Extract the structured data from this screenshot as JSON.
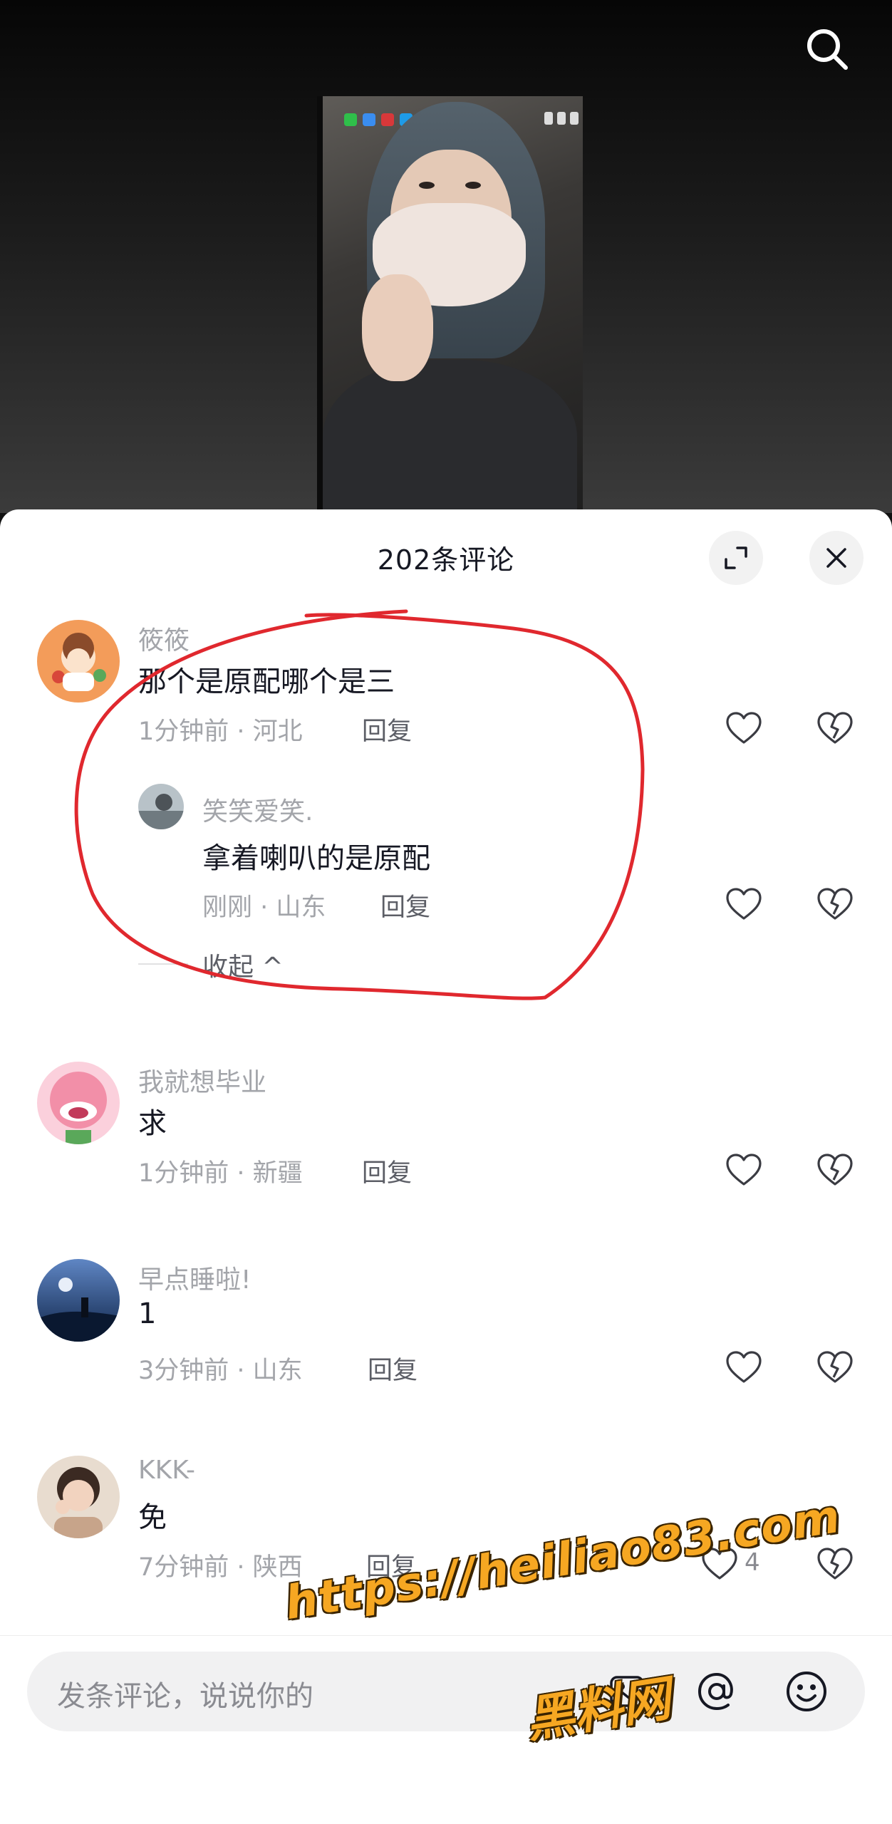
{
  "sheet": {
    "title": "202条评论"
  },
  "comments": [
    {
      "name": "筱筱",
      "text": "那个是原配哪个是三",
      "meta": "1分钟前 · 河北",
      "reply": "回复",
      "avatar_color": "#f39c5a",
      "replies": [
        {
          "name": "笑笑爱笑.",
          "text": "拿着喇叭的是原配",
          "meta": "刚刚 · 山东",
          "reply": "回复",
          "avatar_color": "#b8c2c8"
        }
      ],
      "collapse": "收起 ^"
    },
    {
      "name": "我就想毕业",
      "text": "求",
      "meta": "1分钟前 · 新疆",
      "reply": "回复",
      "avatar_color": "#f28fa8"
    },
    {
      "name": "早点睡啦!",
      "text": "1",
      "meta": "3分钟前 · 山东",
      "reply": "回复",
      "avatar_color": "#2d4f86"
    },
    {
      "name": "KKK-",
      "text": "免",
      "meta": "7分钟前 · 陕西",
      "reply": "回复",
      "like_count": "4",
      "avatar_color": "#c7a48a"
    }
  ],
  "input": {
    "placeholder": "发条评论，说说你的"
  },
  "watermark": {
    "url": "https://heiliao83.com",
    "name": "黑料网"
  },
  "colors": {
    "annotation": "#e0282e",
    "watermark": "#f6a722"
  },
  "icons": [
    "search-icon",
    "expand-icon",
    "close-icon",
    "heart-icon",
    "broken-heart-icon",
    "image-icon",
    "at-icon",
    "emoji-icon"
  ]
}
